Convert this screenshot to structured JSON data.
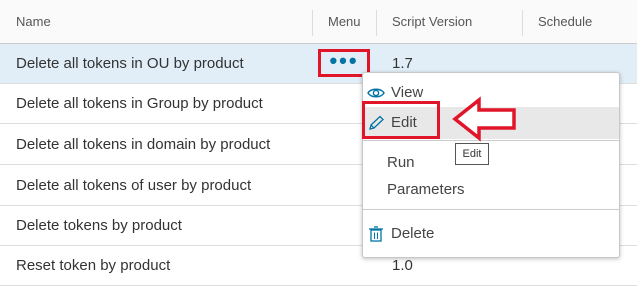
{
  "columns": {
    "name": "Name",
    "menu": "Menu",
    "script_version": "Script Version",
    "schedule": "Schedule"
  },
  "rows": [
    {
      "name": "Delete all tokens in OU by product",
      "version": "1.7"
    },
    {
      "name": "Delete all tokens in Group by product",
      "version": ""
    },
    {
      "name": "Delete all tokens in domain by product",
      "version": ""
    },
    {
      "name": "Delete all tokens of user by product",
      "version": ""
    },
    {
      "name": "Delete tokens by product",
      "version": ""
    },
    {
      "name": "Reset token by product",
      "version": "1.0"
    }
  ],
  "row_menu": {
    "trigger_label": "•••",
    "items": {
      "view": "View",
      "edit": "Edit",
      "run": "Run",
      "parameters": "Parameters",
      "delete": "Delete"
    },
    "tooltip": "Edit"
  },
  "colors": {
    "highlight": "#e0152a",
    "selected_row": "#e1eef8",
    "accent": "#0072a3"
  },
  "icons": {
    "view": "eye-icon",
    "edit": "pencil-icon",
    "delete": "trash-icon",
    "annotation": "arrow-left-icon"
  }
}
